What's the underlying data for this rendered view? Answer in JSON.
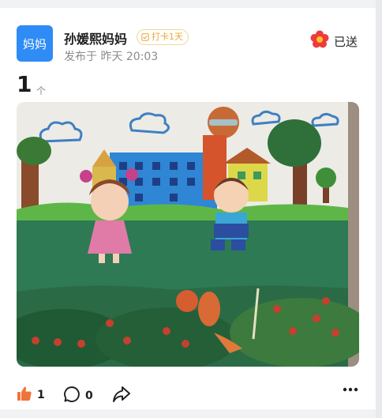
{
  "user": {
    "avatar_text": "妈妈",
    "name": "孙媛熙妈妈",
    "checkin_badge": "打卡1天",
    "post_time": "发布于 昨天 20:03"
  },
  "flower": {
    "icon": "red-flower-icon",
    "status": "已送"
  },
  "count": {
    "value": "1",
    "unit": "个"
  },
  "post_image": {
    "description_icon": "child-drawing-image"
  },
  "actions": {
    "like_count": "1",
    "comment_count": "0",
    "share_icon": "share-icon",
    "more_icon": "more-icon"
  },
  "colors": {
    "avatar_bg": "#2f8bf5",
    "like_orange": "#f0733a",
    "badge_border": "#f3d79a",
    "badge_text": "#e9a83a"
  }
}
